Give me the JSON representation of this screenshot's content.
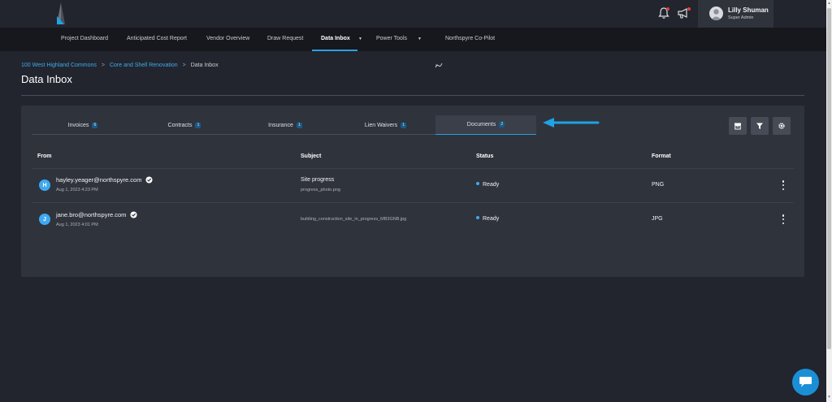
{
  "user": {
    "name": "Lilly Shuman",
    "role": "Super Admin"
  },
  "nav": {
    "items": [
      {
        "label": "Project Dashboard"
      },
      {
        "label": "Anticipated Cost Report"
      },
      {
        "label": "Vendor Overview"
      },
      {
        "label": "Draw Request"
      },
      {
        "label": "Data Inbox",
        "active": true
      },
      {
        "label": "Power Tools"
      },
      {
        "label": "Northspyre Co-Pilot"
      }
    ]
  },
  "breadcrumb": {
    "items": [
      "100 West Highland Commons",
      "Core and Shell Renovation",
      "Data Inbox"
    ],
    "separator": ">"
  },
  "page": {
    "title": "Data Inbox"
  },
  "tabs": [
    {
      "label": "Invoices",
      "count": "6"
    },
    {
      "label": "Contracts",
      "count": "1"
    },
    {
      "label": "Insurance",
      "count": "1"
    },
    {
      "label": "Lien Waivers",
      "count": "1"
    },
    {
      "label": "Documents",
      "count": "2",
      "active": true
    }
  ],
  "table": {
    "columns": [
      "From",
      "Subject",
      "Status",
      "Format"
    ],
    "rows": [
      {
        "initial": "H",
        "from": "hayley.yeager@northspyre.com",
        "date": "Aug 1, 2023 4:23 PM",
        "subject": "Site progress",
        "subject_detail": "progress_photo.png",
        "status": "Ready",
        "format": "PNG"
      },
      {
        "initial": "J",
        "from": "jane.bro@northspyre.com",
        "date": "Aug 1, 2023 4:01 PM",
        "subject": "",
        "subject_detail": "building_construction_site_in_progress_MB3GNB.jpg",
        "status": "Ready",
        "format": "JPG"
      }
    ]
  },
  "icons": {
    "bell": "bell-icon",
    "megaphone": "megaphone-icon",
    "archive": "archive-icon",
    "filter": "filter-icon",
    "settings": "gear-icon",
    "chat": "chat-icon",
    "verified": "verified-check-icon",
    "arrow": "arrow-left-icon"
  },
  "colors": {
    "accent": "#2b9fe3",
    "notification": "#e0413b",
    "panel": "#2f333c",
    "background": "#22252d",
    "nav": "#16181d"
  }
}
